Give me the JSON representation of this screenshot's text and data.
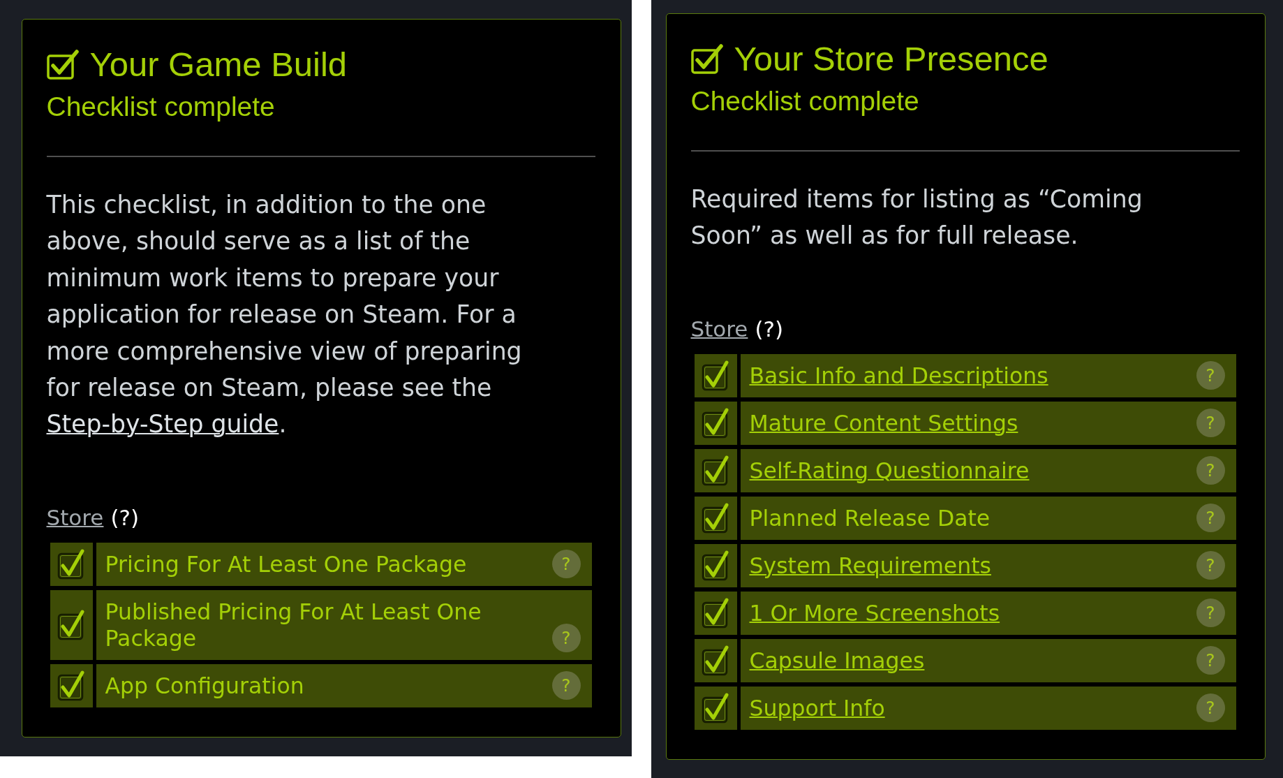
{
  "sections": [
    {
      "title": "Your Game Build",
      "checked": true,
      "status": "Checklist complete",
      "description": [
        {
          "kind": "text",
          "text": "This checklist, in addition to the one above, should serve as a list of the minimum work items to prepare your application for release on Steam. For a more comprehensive view of preparing for release on Steam, please see the "
        },
        {
          "kind": "link",
          "text": "Step-by-Step guide"
        },
        {
          "kind": "text",
          "text": "."
        }
      ],
      "group": {
        "label": "Store",
        "help": "(?)"
      },
      "items": [
        {
          "label": "Pricing For At Least One Package",
          "checked": true,
          "linked": false,
          "help": "?"
        },
        {
          "label": "Published Pricing For At Least One Package",
          "checked": true,
          "linked": false,
          "help": "?"
        },
        {
          "label": "App Configuration",
          "checked": true,
          "linked": false,
          "help": "?"
        }
      ]
    },
    {
      "title": "Your Store Presence",
      "checked": true,
      "status": "Checklist complete",
      "description": [
        {
          "kind": "text",
          "text": "Required items for listing as “Coming Soon” as well as for full release."
        }
      ],
      "group": {
        "label": "Store",
        "help": "(?)"
      },
      "items": [
        {
          "label": "Basic Info and Descriptions",
          "checked": true,
          "linked": true,
          "help": "?"
        },
        {
          "label": "Mature Content Settings",
          "checked": true,
          "linked": true,
          "help": "?"
        },
        {
          "label": "Self-Rating Questionnaire",
          "checked": true,
          "linked": true,
          "help": "?"
        },
        {
          "label": "Planned Release Date",
          "checked": true,
          "linked": false,
          "help": "?"
        },
        {
          "label": "System Requirements",
          "checked": true,
          "linked": true,
          "help": "?"
        },
        {
          "label": "1 Or More Screenshots",
          "checked": true,
          "linked": true,
          "help": "?"
        },
        {
          "label": "Capsule Images",
          "checked": true,
          "linked": true,
          "help": "?"
        },
        {
          "label": "Support Info",
          "checked": true,
          "linked": true,
          "help": "?"
        }
      ]
    }
  ]
}
